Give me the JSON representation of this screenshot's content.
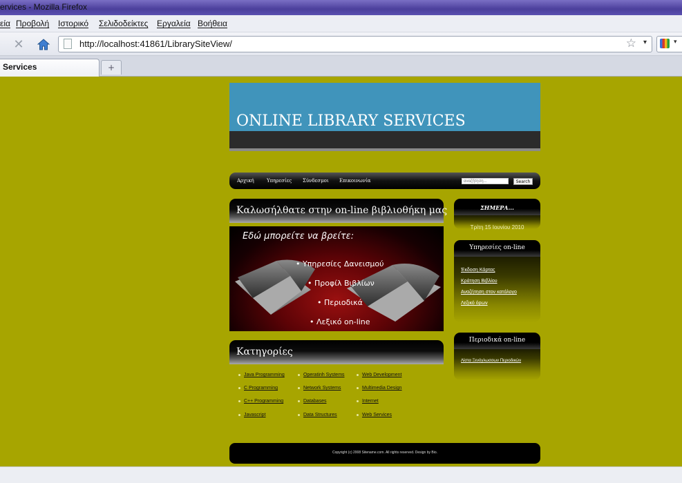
{
  "browser": {
    "title": "ervices - Mozilla Firefox",
    "menu": [
      "εία",
      "Προβολή",
      "Ιστορικό",
      "Σελιδοδείκτες",
      "Εργαλεία",
      "Βοήθεια"
    ],
    "url": "http://localhost:41861/LibrarySiteView/",
    "tab_title": "Services",
    "new_tab_label": "+"
  },
  "site": {
    "title": "ONLINE LIBRARY SERVICES",
    "nav": [
      "Αρχική",
      "Υπηρεσίες",
      "Σύνδεσμοι",
      "Επικοινωνία"
    ],
    "search_placeholder": "αναζήτηση...",
    "search_button": "Search",
    "welcome": "Καλωσήλθατε στην on-line βιβλιοθήκη μας",
    "banner": {
      "heading": "Εδώ μπορείτε να βρείτε:",
      "items": [
        "• Υπηρεσίες Δανεισμού",
        "• Προφίλ Βιβλίων",
        "• Περιοδικά",
        "• Λεξικό on-line"
      ]
    },
    "categories_title": "Κατηγορίες",
    "categories": [
      [
        "Java Programming",
        "C Programming",
        "C++ Programming",
        "Javascript"
      ],
      [
        "Operatinh Systems",
        "Network Systems",
        "Databases",
        "Data Structures"
      ],
      [
        "Web Development",
        "Multimedia Design",
        "Internet",
        "Web Services"
      ]
    ],
    "footer": "Copyright (c) 2008 Sitename.com. All rights reserved. Design by Bio.",
    "sidebar": {
      "today": {
        "title": "ΣΗΜΕΡΑ...",
        "date": "Τρίτη 15 Ιουνίου 2010"
      },
      "services": {
        "title": "Υπηρεσίες on-line",
        "links": [
          "Έκδοση Κάρτας",
          "Κράτηση Βιβλίου",
          "Αναζήτηση στον κατάλογο",
          "Λεξικό όρων"
        ]
      },
      "periodicals": {
        "title": "Περιοδικά on-line",
        "links": [
          "Λίστα Ξενόγλωσσων Περιοδικών"
        ]
      }
    }
  }
}
